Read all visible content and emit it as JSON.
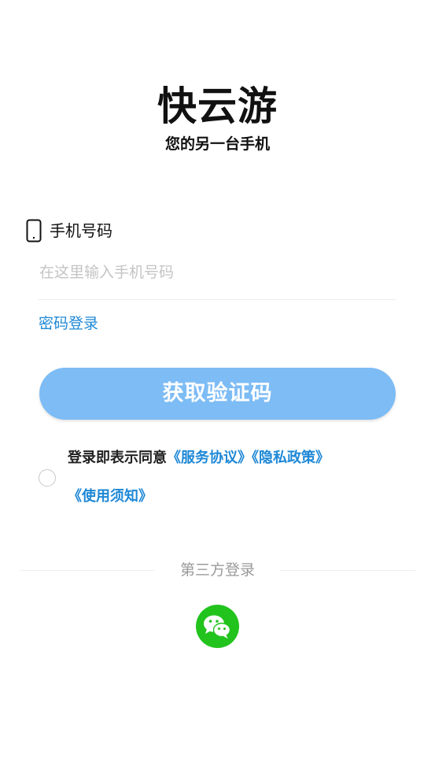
{
  "app": {
    "title": "快云游",
    "slogan": "您的另一台手机"
  },
  "login_form": {
    "phone_label": "手机号码",
    "phone_placeholder": "在这里输入手机号码",
    "phone_value": "",
    "password_login_link": "密码登录",
    "get_code_button": "获取验证码"
  },
  "agreement": {
    "checked": false,
    "prefix": "登录即表示同意",
    "service_agreement": "《服务协议》",
    "privacy_policy": "《隐私政策》",
    "usage_notice": "《使用须知》"
  },
  "third_party": {
    "label": "第三方登录",
    "wechat_icon": "wechat-icon"
  },
  "colors": {
    "accent_blue": "#1e88d6",
    "button_blue": "#7dbcf5",
    "wechat_green": "#22c31d"
  }
}
